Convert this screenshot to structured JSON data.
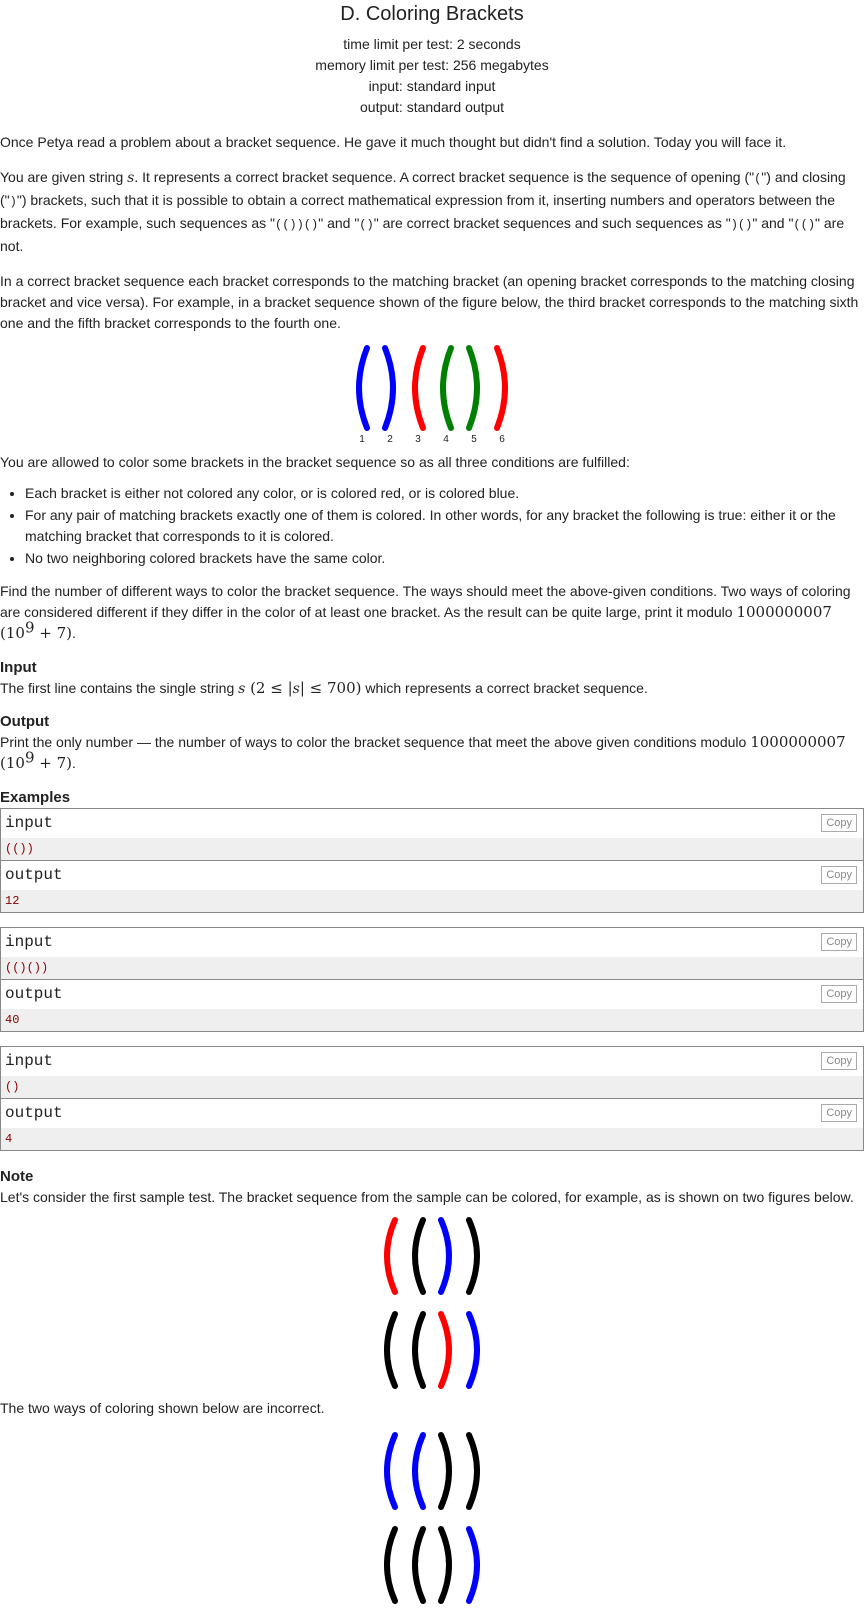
{
  "title": "D. Coloring Brackets",
  "limits": {
    "time": "time limit per test: 2 seconds",
    "memory": "memory limit per test: 256 megabytes",
    "input": "input: standard input",
    "output": "output: standard output"
  },
  "statement": {
    "p1": "Once Petya read a problem about a bracket sequence. He gave it much thought but didn't find a solution. Today you will face it.",
    "p2_a": "You are given string ",
    "p2_var": "s",
    "p2_b": ". It represents a correct bracket sequence. A correct bracket sequence is the sequence of opening (\"",
    "p2_open": "(",
    "p2_c": "\") and closing (\"",
    "p2_close": ")",
    "p2_d": "\") brackets, such that it is possible to obtain a correct mathematical expression from it, inserting numbers and operators between the brackets. For example, such sequences as \"",
    "p2_ex1": "(())()",
    "p2_e": "\" and \"",
    "p2_ex2": "()",
    "p2_f": "\" are correct bracket sequences and such sequences as \"",
    "p2_ex3": ")()",
    "p2_g": "\" and \"",
    "p2_ex4": "(()",
    "p2_h": "\" are not.",
    "p3": "In a correct bracket sequence each bracket corresponds to the matching bracket (an opening bracket corresponds to the matching closing bracket and vice versa). For example, in a bracket sequence shown of the figure below, the third bracket corresponds to the matching sixth one and the fifth bracket corresponds to the fourth one.",
    "figure_brackets": [
      {
        "ch": "(",
        "color": "#0000ff",
        "num": "1"
      },
      {
        "ch": ")",
        "color": "#0000ff",
        "num": "2"
      },
      {
        "ch": "(",
        "color": "#ff0000",
        "num": "3"
      },
      {
        "ch": "(",
        "color": "#008000",
        "num": "4"
      },
      {
        "ch": ")",
        "color": "#008000",
        "num": "5"
      },
      {
        "ch": ")",
        "color": "#ff0000",
        "num": "6"
      }
    ],
    "p4": "You are allowed to color some brackets in the bracket sequence so as all three conditions are fulfilled:",
    "conditions": [
      "Each bracket is either not colored any color, or is colored red, or is colored blue.",
      "For any pair of matching brackets exactly one of them is colored. In other words, for any bracket the following is true: either it or the matching bracket that corresponds to it is colored.",
      "No two neighboring colored brackets have the same color."
    ],
    "p5_a": "Find the number of different ways to color the bracket sequence. The ways should meet the above-given conditions. Two ways of coloring are considered different if they differ in the color of at least one bracket. As the result can be quite large, print it modulo ",
    "p5_mod": "1000000007",
    "p5_b_open": "(10",
    "p5_exp": "9",
    "p5_b_close": " + 7)",
    "p5_end": "."
  },
  "input_section": {
    "heading": "Input",
    "text_a": "The first line contains the single string ",
    "var": "s",
    "cond_open": " (2 ≤ |",
    "cond_var": "s",
    "cond_close": "| ≤ 700)",
    "text_b": " which represents a correct bracket sequence."
  },
  "output_section": {
    "heading": "Output",
    "text_a": "Print the only number — the number of ways to color the bracket sequence that meet the above given conditions modulo ",
    "mod": "1000000007",
    "b_open": "(10",
    "exp": "9",
    "b_close": " + 7)",
    "end": "."
  },
  "examples_heading": "Examples",
  "examples": [
    {
      "input_label": "input",
      "input": "(())",
      "output_label": "output",
      "output": "12",
      "copy": "Copy"
    },
    {
      "input_label": "input",
      "input": "(()())",
      "output_label": "output",
      "output": "40",
      "copy": "Copy"
    },
    {
      "input_label": "input",
      "input": "()",
      "output_label": "output",
      "output": "4",
      "copy": "Copy"
    }
  ],
  "note": {
    "heading": "Note",
    "p1": "Let's consider the first sample test. The bracket sequence from the sample can be colored, for example, as is shown on two figures below.",
    "correct_figures": [
      [
        {
          "ch": "(",
          "color": "#ff0000"
        },
        {
          "ch": "(",
          "color": "#000000"
        },
        {
          "ch": ")",
          "color": "#0000ff"
        },
        {
          "ch": ")",
          "color": "#000000"
        }
      ],
      [
        {
          "ch": "(",
          "color": "#000000"
        },
        {
          "ch": "(",
          "color": "#000000"
        },
        {
          "ch": ")",
          "color": "#ff0000"
        },
        {
          "ch": ")",
          "color": "#0000ff"
        }
      ]
    ],
    "p2": "The two ways of coloring shown below are incorrect.",
    "incorrect_figures": [
      [
        {
          "ch": "(",
          "color": "#0000ff"
        },
        {
          "ch": "(",
          "color": "#0000ff"
        },
        {
          "ch": ")",
          "color": "#000000"
        },
        {
          "ch": ")",
          "color": "#000000"
        }
      ],
      [
        {
          "ch": "(",
          "color": "#000000"
        },
        {
          "ch": "(",
          "color": "#000000"
        },
        {
          "ch": ")",
          "color": "#000000"
        },
        {
          "ch": ")",
          "color": "#0000ff"
        }
      ]
    ]
  }
}
